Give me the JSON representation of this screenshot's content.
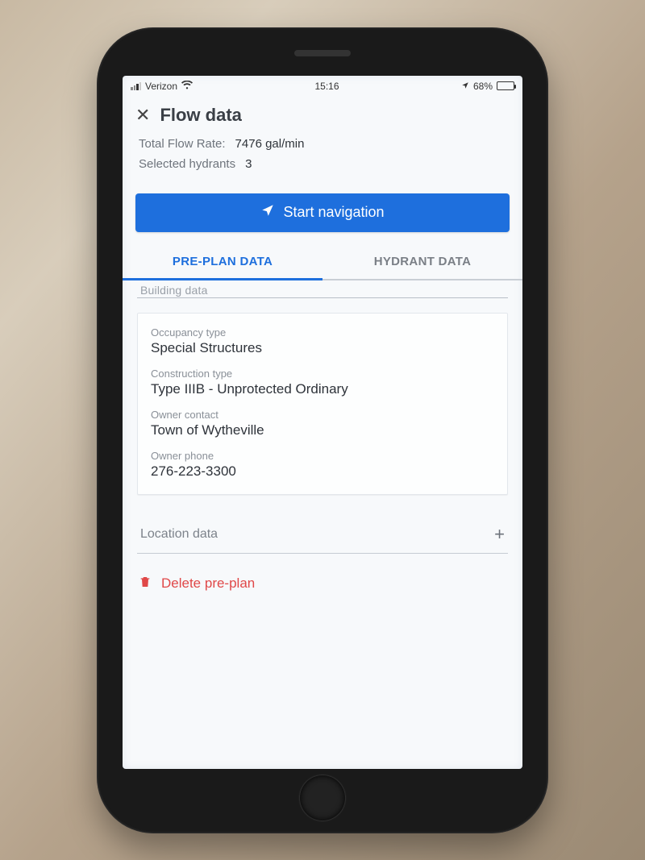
{
  "status": {
    "carrier": "Verizon",
    "time": "15:16",
    "battery_pct": "68%"
  },
  "header": {
    "title": "Flow data"
  },
  "summary": {
    "flow_label": "Total Flow Rate:",
    "flow_value": "7476 gal/min",
    "hydrants_label": "Selected hydrants",
    "hydrants_value": "3"
  },
  "nav_button": "Start navigation",
  "tabs": {
    "preplan": "PRE-PLAN DATA",
    "hydrant": "HYDRANT DATA",
    "active": "preplan"
  },
  "peek_section": "Building data",
  "card": {
    "occupancy_label": "Occupancy type",
    "occupancy_value": "Special Structures",
    "construction_label": "Construction type",
    "construction_value": "Type IIIB - Unprotected Ordinary",
    "owner_label": "Owner contact",
    "owner_value": "Town of Wytheville",
    "phone_label": "Owner phone",
    "phone_value": "276-223-3300"
  },
  "location_section": "Location data",
  "delete_label": "Delete pre-plan"
}
